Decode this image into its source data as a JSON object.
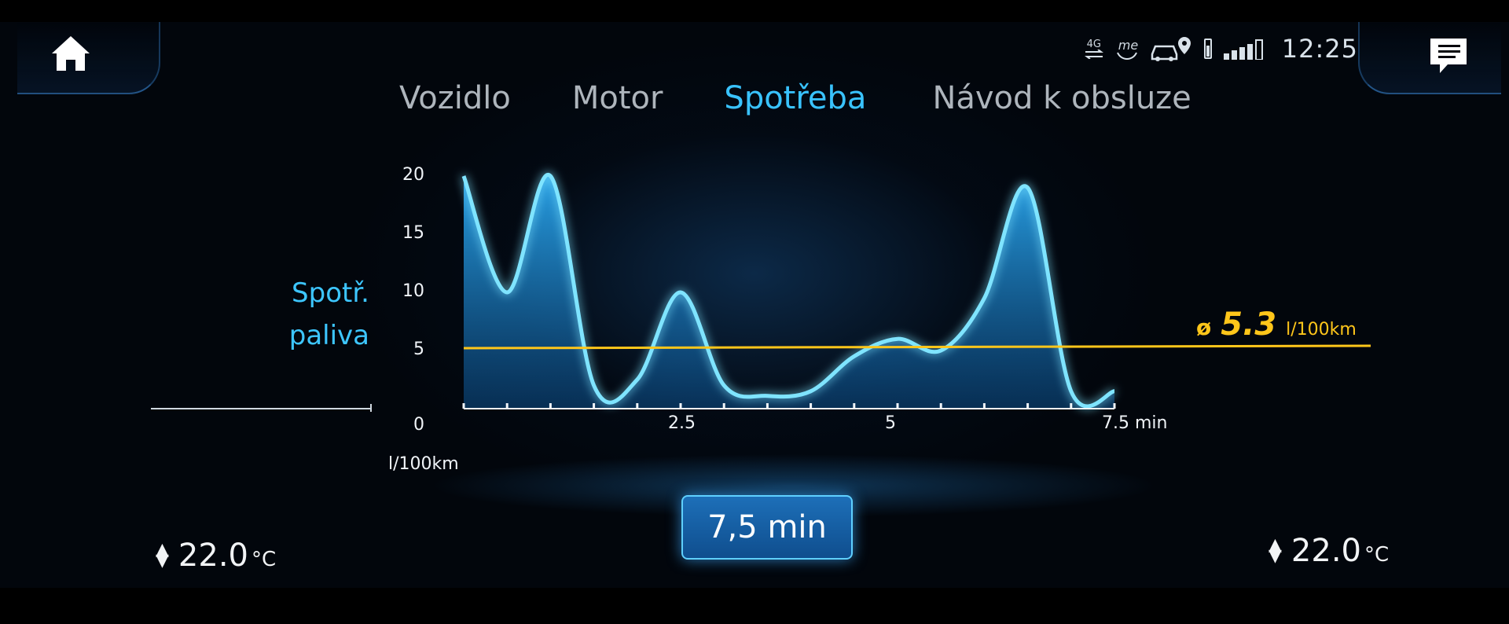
{
  "status_bar": {
    "network_label": "4G",
    "me_label": "me",
    "icons": [
      "network-4g-icon",
      "mercedes-me-icon",
      "car-location-icon",
      "battery-icon",
      "signal-strength-icon"
    ],
    "time": "12:25"
  },
  "tabs": [
    {
      "label": "Vozidlo",
      "active": false
    },
    {
      "label": "Motor",
      "active": false
    },
    {
      "label": "Spotřeba",
      "active": true
    },
    {
      "label": "Návod k obsluze",
      "active": false
    }
  ],
  "colors": {
    "accent": "#39c3ff",
    "average_line": "#ffc61a",
    "curve": "#5fdcff"
  },
  "chart_data": {
    "type": "area",
    "ylabel_line1": "Spotř.",
    "ylabel_line2": "paliva",
    "y_unit": "l/100km",
    "x_unit": "min",
    "ylim": [
      0,
      20
    ],
    "xlim": [
      0,
      7.5
    ],
    "y_ticks": [
      "20",
      "15",
      "10",
      "5",
      "0"
    ],
    "x_ticks": [
      "2.5",
      "5",
      "7.5 min"
    ],
    "x": [
      0,
      0.5,
      1.0,
      1.5,
      2.0,
      2.5,
      3.0,
      3.5,
      4.0,
      4.5,
      5.0,
      5.5,
      6.0,
      6.5,
      7.0,
      7.5
    ],
    "values": [
      20,
      10,
      20,
      2,
      2.5,
      10,
      2,
      1.1,
      1.5,
      4.5,
      6,
      5,
      9.5,
      19,
      1.5,
      1.5
    ],
    "average": 5.2,
    "average_symbol": "ø",
    "average_label": "5.3",
    "average_unit": "l/100km"
  },
  "range_button_label": "7,5 min",
  "climate": {
    "left_temp": "22.0",
    "right_temp": "22.0",
    "unit": "°C",
    "arrow_up": "▲",
    "arrow_down": "▼"
  }
}
